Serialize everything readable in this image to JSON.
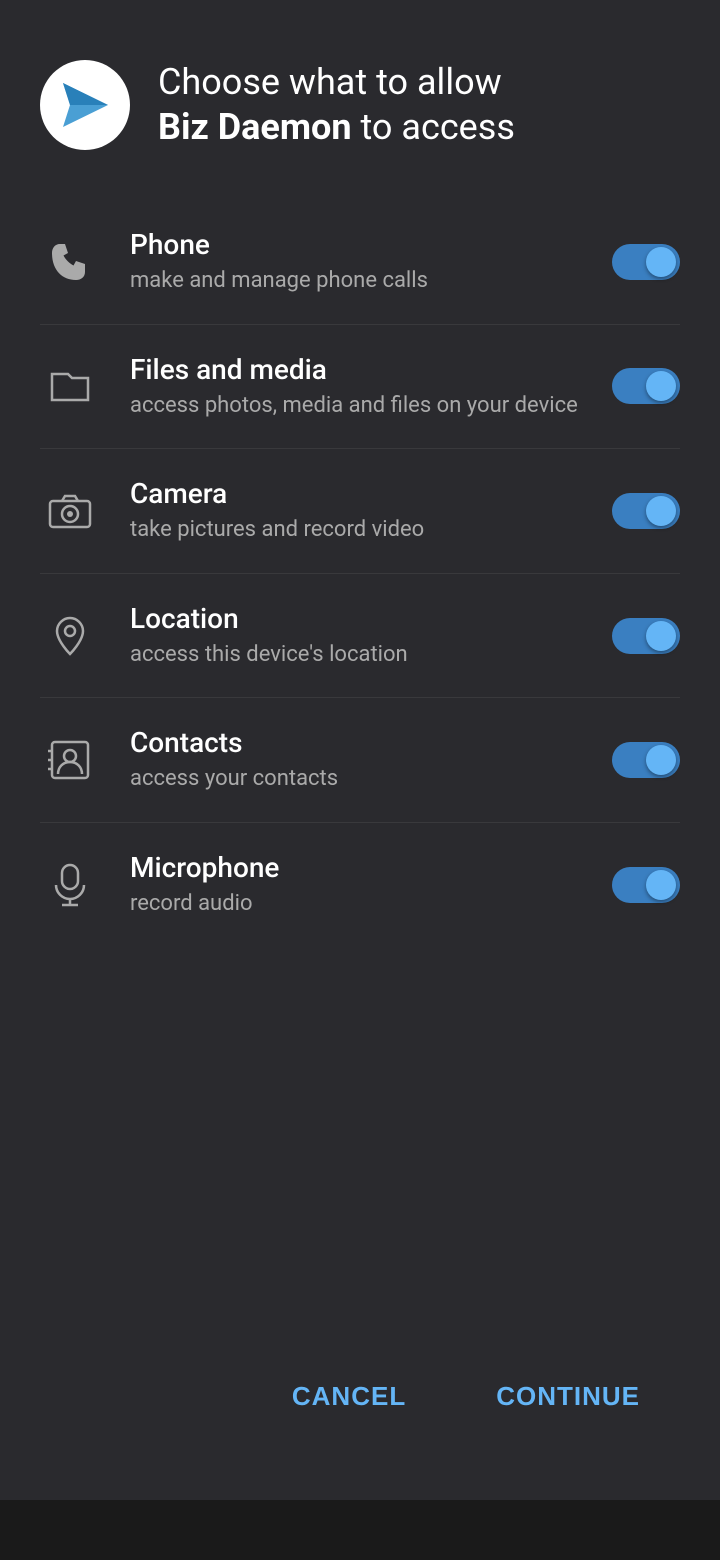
{
  "header": {
    "title_line1": "Choose what to allow",
    "app_name": "Biz Daemon",
    "title_line2": "to access"
  },
  "permissions": [
    {
      "id": "phone",
      "title": "Phone",
      "description": "make and manage phone calls",
      "enabled": true,
      "icon": "phone"
    },
    {
      "id": "files",
      "title": "Files and media",
      "description": "access photos, media and files on your device",
      "enabled": true,
      "icon": "folder"
    },
    {
      "id": "camera",
      "title": "Camera",
      "description": "take pictures and record video",
      "enabled": true,
      "icon": "camera"
    },
    {
      "id": "location",
      "title": "Location",
      "description": "access this device's location",
      "enabled": true,
      "icon": "location"
    },
    {
      "id": "contacts",
      "title": "Contacts",
      "description": "access your contacts",
      "enabled": true,
      "icon": "contacts"
    },
    {
      "id": "microphone",
      "title": "Microphone",
      "description": "record audio",
      "enabled": true,
      "icon": "microphone"
    }
  ],
  "buttons": {
    "cancel": "CANCEL",
    "continue": "CONTINUE"
  },
  "colors": {
    "accent": "#64b5f6",
    "toggle_track": "#3a7fc1",
    "background": "#2a2a2e",
    "icon_color": "#aaaaaa"
  }
}
